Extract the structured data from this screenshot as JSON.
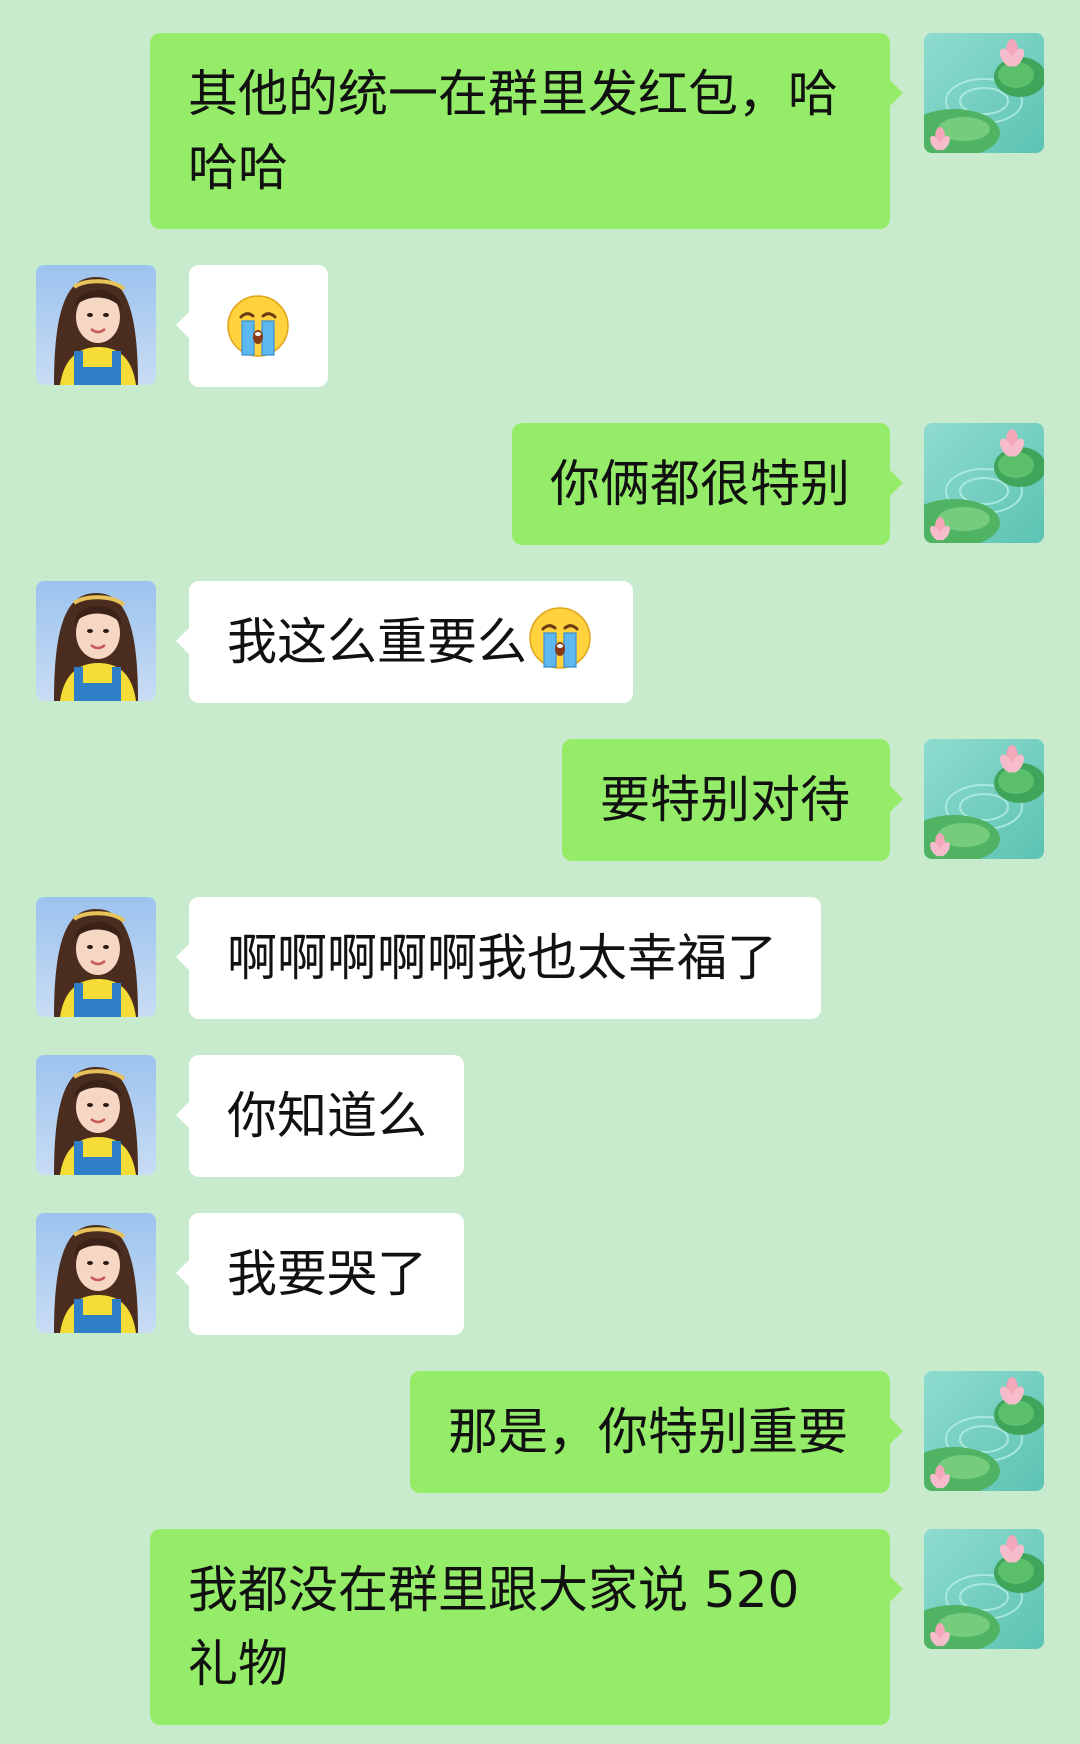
{
  "conversation": {
    "messages": [
      {
        "side": "out",
        "text": "其他的统一在群里发红包，哈哈哈",
        "emoji": ""
      },
      {
        "side": "in",
        "text": "",
        "emoji": "loudly-crying-face"
      },
      {
        "side": "out",
        "text": "你俩都很特别",
        "emoji": ""
      },
      {
        "side": "in",
        "text": "我这么重要么",
        "emoji": "loudly-crying-face"
      },
      {
        "side": "out",
        "text": "要特别对待",
        "emoji": ""
      },
      {
        "side": "in",
        "text": "啊啊啊啊啊我也太幸福了",
        "emoji": ""
      },
      {
        "side": "in",
        "text": "你知道么",
        "emoji": ""
      },
      {
        "side": "in",
        "text": "我要哭了",
        "emoji": ""
      },
      {
        "side": "out",
        "text": "那是，你特别重要",
        "emoji": ""
      },
      {
        "side": "out",
        "text": "我都没在群里跟大家说 520 礼物",
        "emoji": ""
      }
    ]
  },
  "colors": {
    "background": "#c8ebce",
    "outgoing_bubble": "#95ec69",
    "incoming_bubble": "#ffffff",
    "text": "#111111"
  },
  "icons": {
    "outgoing_avatar": "lotus-pond-avatar",
    "incoming_avatar": "girl-portrait-avatar",
    "reaction_emoji": "loudly-crying-face"
  }
}
